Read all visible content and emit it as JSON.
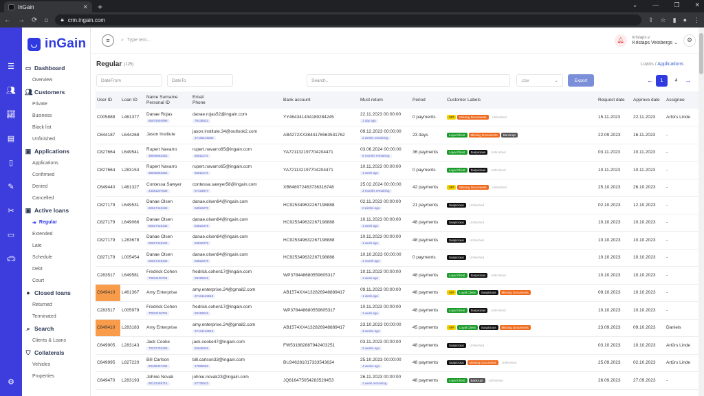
{
  "browser": {
    "tab_title": "InGain",
    "url": "crm.ingain.com"
  },
  "app": {
    "logo_text": "inGain",
    "brand_color": "#2f3be0"
  },
  "topbar": {
    "search_placeholder": "Type text...",
    "user_small": "kristaps.v",
    "user_name": "Kristaps Veinbergs"
  },
  "sidebar": {
    "sections": [
      {
        "label": "Dashboard",
        "icon": "monitor-icon",
        "items": [
          "Overview"
        ]
      },
      {
        "label": "Customers",
        "icon": "users-icon",
        "items": [
          "Private",
          "Business",
          "Black list",
          "Unfinished"
        ]
      },
      {
        "label": "Applications",
        "icon": "folder-icon",
        "items": [
          "Applications",
          "Confirmed",
          "Denied",
          "Cancelled"
        ]
      },
      {
        "label": "Active loans",
        "icon": "folder-icon",
        "items": [
          "Regular",
          "Extended",
          "Late",
          "Schedule",
          "Debt",
          "Court"
        ]
      },
      {
        "label": "Closed loans",
        "icon": "check-circle-icon",
        "items": [
          "Returned",
          "Terminated"
        ]
      },
      {
        "label": "Search",
        "icon": "search-icon",
        "items": [
          "Clients & Loans"
        ]
      },
      {
        "label": "Collaterals",
        "icon": "shield-icon",
        "items": [
          "Vehicles",
          "Properties"
        ]
      }
    ],
    "active_item": "Regular"
  },
  "page": {
    "title": "Regular",
    "count": "(125)",
    "breadcrumb": [
      "Loans",
      "Applications"
    ]
  },
  "filters": {
    "date_from_placeholder": "DateFrom",
    "date_to_placeholder": "DateTo",
    "search_placeholder": "Search..",
    "format_value": ".csv",
    "export_label": "Export"
  },
  "pagination": {
    "pages": [
      "1",
      "4"
    ],
    "current": "1"
  },
  "table": {
    "headers": [
      "User ID",
      "Loan ID",
      "Name Surname\nPersonal ID",
      "Email\nPhone",
      "Bank account",
      "Must return",
      "Period",
      "Customer Labels",
      "Request date",
      "Approve date",
      "Assignee"
    ],
    "rows": [
      {
        "user_id": "C005888",
        "loan_id": "L461377",
        "name": "Danae Rojas",
        "pid": "86974694996",
        "email": "danae.rojas52@ingain.com",
        "phone": "76438623",
        "bank": "YY464341434189284245",
        "must_return": "22.11.2023 00:00:00",
        "remain": "1 day ago",
        "period": "0 payments",
        "labels": [
          "VIP",
          "Missing Documents",
          "Unfinished"
        ],
        "req": "15.11.2023",
        "appr": "22.11.2023",
        "assignee": "Artūrs Linde",
        "hl": false
      },
      {
        "user_id": "C644187",
        "loan_id": "L644268",
        "name": "Jason Institute",
        "pid": "",
        "email": "jason.institute.34@outlook2.com",
        "phone": "37136148282",
        "bank": "AB4272XX3844176563531762",
        "must_return": "09.12.2023 00:00:00",
        "remain": "2 weeks remaining",
        "period": "23 days",
        "labels": [
          "Loyal Client",
          "Missing Documents",
          "Bankrupt"
        ],
        "req": "22.09.2023",
        "appr": "16.11.2023",
        "assignee": "-",
        "hl": false
      },
      {
        "user_id": "C827664",
        "loan_id": "L649541",
        "name": "Rupert Navarro",
        "pid": "38935963362",
        "email": "rupert.navarro65@ingain.com",
        "phone": "65811374",
        "bank": "YA721132197704204471",
        "must_return": "03.06.2024 00:00:00",
        "remain": "6 months remaining",
        "period": "36 payments",
        "labels": [
          "Loyal Client",
          "Suspicious",
          "Unfinished"
        ],
        "req": "03.11.2023",
        "appr": "10.11.2023",
        "assignee": "-",
        "hl": false
      },
      {
        "user_id": "C827664",
        "loan_id": "L283153",
        "name": "Rupert Navarro",
        "pid": "38935963362",
        "email": "rupert.navarro65@ingain.com",
        "phone": "65811374",
        "bank": "YA721132197704204471",
        "must_return": "10.11.2023 00:00:00",
        "remain": "1 week ago",
        "period": "0 payments",
        "labels": [
          "Loyal Client",
          "Suspicious",
          "Unfinished"
        ],
        "req": "10.11.2023",
        "appr": "10.11.2023",
        "assignee": "-",
        "hl": false
      },
      {
        "user_id": "C649440",
        "loan_id": "L461327",
        "name": "Contessa Sawyer",
        "pid": "24381207635",
        "email": "contessa.sawyer58@ingain.com",
        "phone": "67433874",
        "bank": "XB648072463736316748",
        "must_return": "25.02.2024 00:00:00",
        "remain": "3 months remaining",
        "period": "42 payments",
        "labels": [
          "VIP",
          "Missing Documents",
          "Unfinished"
        ],
        "req": "25.10.2023",
        "appr": "26.10.2023",
        "assignee": "-",
        "hl": false
      },
      {
        "user_id": "C827179",
        "loan_id": "L649531",
        "name": "Danae Olsen",
        "pid": "50617418132",
        "email": "danae.olsen84@ingain.com",
        "phone": "53822379",
        "bank": "HC925349632267198888",
        "must_return": "02.11.2023 00:00:00",
        "remain": "2 weeks ago",
        "period": "21 payments",
        "labels": [
          "Suspicious",
          "Unfinished"
        ],
        "req": "02.10.2023",
        "appr": "12.10.2023",
        "assignee": "-",
        "hl": false
      },
      {
        "user_id": "C827179",
        "loan_id": "L649066",
        "name": "Danae Olsen",
        "pid": "50617418132",
        "email": "danae.olsen84@ingain.com",
        "phone": "53822379",
        "bank": "HC925349632267198888",
        "must_return": "10.11.2023 00:00:00",
        "remain": "1 week ago",
        "period": "48 payments",
        "labels": [
          "Suspicious",
          "Unfinished"
        ],
        "req": "10.10.2023",
        "appr": "10.10.2023",
        "assignee": "-",
        "hl": false
      },
      {
        "user_id": "C827179",
        "loan_id": "L283678",
        "name": "Danae Olsen",
        "pid": "50617418132",
        "email": "danae.olsen84@ingain.com",
        "phone": "53822379",
        "bank": "HC925349632267198888",
        "must_return": "10.11.2023 00:00:00",
        "remain": "1 week ago",
        "period": "48 payments",
        "labels": [
          "Suspicious",
          "Unfinished"
        ],
        "req": "10.10.2023",
        "appr": "10.10.2023",
        "assignee": "-",
        "hl": false
      },
      {
        "user_id": "C827179",
        "loan_id": "L005454",
        "name": "Danae Olsen",
        "pid": "50617418132",
        "email": "danae.olsen84@ingain.com",
        "phone": "53822379",
        "bank": "HC925349632267198888",
        "must_return": "10.10.2023 00:00:00",
        "remain": "1 month ago",
        "period": "0 payments",
        "labels": [
          "Suspicious",
          "Unfinished"
        ],
        "req": "10.10.2023",
        "appr": "10.10.2023",
        "assignee": "-",
        "hl": false
      },
      {
        "user_id": "C283517",
        "loan_id": "L649581",
        "name": "Fredrick Cohen",
        "pid": "70601136765",
        "email": "fredrick.cohen17@ingain.com",
        "phone": "58158616",
        "bank": "WP378448680559605317",
        "must_return": "10.11.2023 00:00:00",
        "remain": "1 week ago",
        "period": "48 payments",
        "labels": [
          "Loyal Client",
          "Suspicious",
          "Unfinished"
        ],
        "req": "10.10.2023",
        "appr": "10.10.2023",
        "assignee": "-",
        "hl": false
      },
      {
        "user_id": "C649410",
        "loan_id": "L461367",
        "name": "Amy Enterprise",
        "pid": "",
        "email": "amy.enterprise.24@gmail2.com",
        "phone": "37131123519",
        "bank": "AB1574XX4132826948889417",
        "must_return": "09.11.2023 00:00:00",
        "remain": "1 week ago",
        "period": "48 payments",
        "labels": [
          "VIP",
          "Loyal Client",
          "Suspicious",
          "Missing Documents"
        ],
        "req": "09.10.2023",
        "appr": "10.10.2023",
        "assignee": "-",
        "hl": true
      },
      {
        "user_id": "C283517",
        "loan_id": "L005979",
        "name": "Fredrick Cohen",
        "pid": "70601136765",
        "email": "fredrick.cohen17@ingain.com",
        "phone": "58158616",
        "bank": "WP378448680559605317",
        "must_return": "10.11.2023 00:00:00",
        "remain": "1 week ago",
        "period": "48 payments",
        "labels": [
          "Loyal Client",
          "Suspicious",
          "Unfinished"
        ],
        "req": "10.10.2023",
        "appr": "10.10.2023",
        "assignee": "-",
        "hl": false
      },
      {
        "user_id": "C649410",
        "loan_id": "L283183",
        "name": "Amy Enterprise",
        "pid": "",
        "email": "amy.enterprise.24@gmail2.com",
        "phone": "37131123519",
        "bank": "AB1574XX4132826948889417",
        "must_return": "23.10.2023 00:00:00",
        "remain": "3 weeks ago",
        "period": "45 payments",
        "labels": [
          "VIP",
          "Loyal Client",
          "Suspicious",
          "Missing Documents"
        ],
        "req": "23.09.2023",
        "appr": "09.10.2023",
        "assignee": "Daniels",
        "hl": true
      },
      {
        "user_id": "C649905",
        "loan_id": "L283143",
        "name": "Jack Cooke",
        "pid": "70221782168",
        "email": "jack.cooke47@ingain.com",
        "phone": "55945626",
        "bank": "FW531882887942403251",
        "must_return": "03.11.2023 00:00:00",
        "remain": "2 weeks ago",
        "period": "48 payments",
        "labels": [
          "Suspicious",
          "Unfinished"
        ],
        "req": "03.10.2023",
        "appr": "10.10.2023",
        "assignee": "Artūrs Linde",
        "hl": false
      },
      {
        "user_id": "C649995",
        "loan_id": "L827220",
        "name": "Bill Carlson",
        "pid": "69489457184",
        "email": "bill.carlson33@ingain.com",
        "phone": "17888556",
        "bank": "BU346281017333543634",
        "must_return": "25.10.2023 00:00:00",
        "remain": "4 weeks ago",
        "period": "48 payments",
        "labels": [
          "Suspicious",
          "Missing Documents",
          "Unfinished"
        ],
        "req": "25.09.2023",
        "appr": "02.10.2023",
        "assignee": "Artūrs Linde",
        "hl": false
      },
      {
        "user_id": "C649470",
        "loan_id": "L283193",
        "name": "Johnie Novak",
        "pid": "90122465714",
        "email": "johnie.novak23@ingain.com",
        "phone": "57735523",
        "bank": "JQ616475054283529453",
        "must_return": "26.11.2023 00:00:00",
        "remain": "1 week remaining",
        "period": "48 payments",
        "labels": [
          "Loyal Client",
          "Bankrupt",
          "Unfinished"
        ],
        "req": "26.09.2023",
        "appr": "27.09.2023",
        "assignee": "-",
        "hl": false
      }
    ]
  }
}
